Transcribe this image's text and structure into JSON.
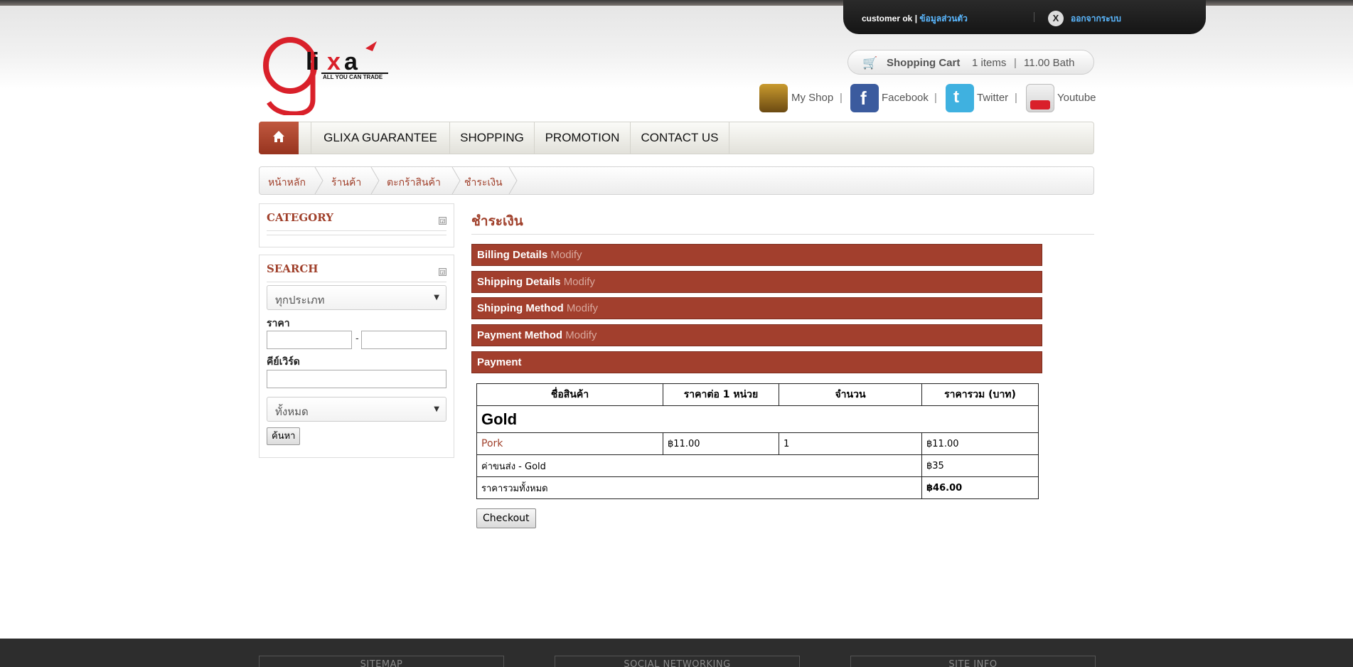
{
  "user_bar": {
    "username": "customer ok",
    "divider": "|",
    "profile_link": "ข้อมูลส่วนตัว",
    "close_glyph": "X",
    "logout": "ออกจากระบบ"
  },
  "logo": {
    "brand": "glixa",
    "tagline": "ALL YOU CAN TRADE"
  },
  "cart": {
    "label": "Shopping Cart",
    "items": "1 items",
    "divider": "|",
    "total": "11.00 Bath",
    "icon": "cart-icon"
  },
  "social": [
    {
      "label": "My Shop",
      "icon": "shop-icon"
    },
    {
      "label": "Facebook",
      "icon": "facebook-icon"
    },
    {
      "label": "Twitter",
      "icon": "twitter-icon"
    },
    {
      "label": "Youtube",
      "icon": "youtube-icon"
    }
  ],
  "social_sep": "|",
  "nav": {
    "home_icon": "home-icon",
    "items": [
      "GLIXA GUARANTEE",
      "SHOPPING",
      "PROMOTION",
      "CONTACT US"
    ]
  },
  "breadcrumb": [
    "หน้าหลัก",
    "ร้านค้า",
    "ตะกร้าสินค้า",
    "ชำระเงิน"
  ],
  "sidebar": {
    "category": {
      "title": "CATEGORY"
    },
    "search": {
      "title": "SEARCH",
      "type_select": "ทุกประเภท",
      "price_label": "ราคา",
      "price_dash": "-",
      "keyword_label": "คีย์เวิร์ด",
      "scope_select": "ทั้งหมด",
      "button": "ค้นหา"
    }
  },
  "main": {
    "title": "ชำระเงิน",
    "steps": [
      {
        "label": "Billing Details",
        "modify": "Modify"
      },
      {
        "label": "Shipping Details",
        "modify": "Modify"
      },
      {
        "label": "Shipping Method",
        "modify": "Modify"
      },
      {
        "label": "Payment Method",
        "modify": "Modify"
      },
      {
        "label": "Payment",
        "modify": ""
      }
    ],
    "table": {
      "headers": [
        "ชื่อสินค้า",
        "ราคาต่อ 1 หน่วย",
        "จำนวน",
        "ราคารวม (บาท)"
      ],
      "group": "Gold",
      "row": {
        "name": "Pork",
        "unit_price": "฿11.00",
        "qty": "1",
        "total": "฿11.00"
      },
      "shipping_label": "ค่าขนส่ง - Gold",
      "shipping_value": "฿35",
      "grand_label": "ราคารวมทั้งหมด",
      "grand_value": "฿46.00"
    },
    "checkout": "Checkout"
  },
  "footer": [
    "SITEMAP",
    "SOCIAL NETWORKING",
    "SITE INFO"
  ],
  "colors": {
    "brand": "#a0402b",
    "step_bg": "#a23f2d",
    "link_blue": "#5bb8ff",
    "footer": "#2d2d2d"
  }
}
